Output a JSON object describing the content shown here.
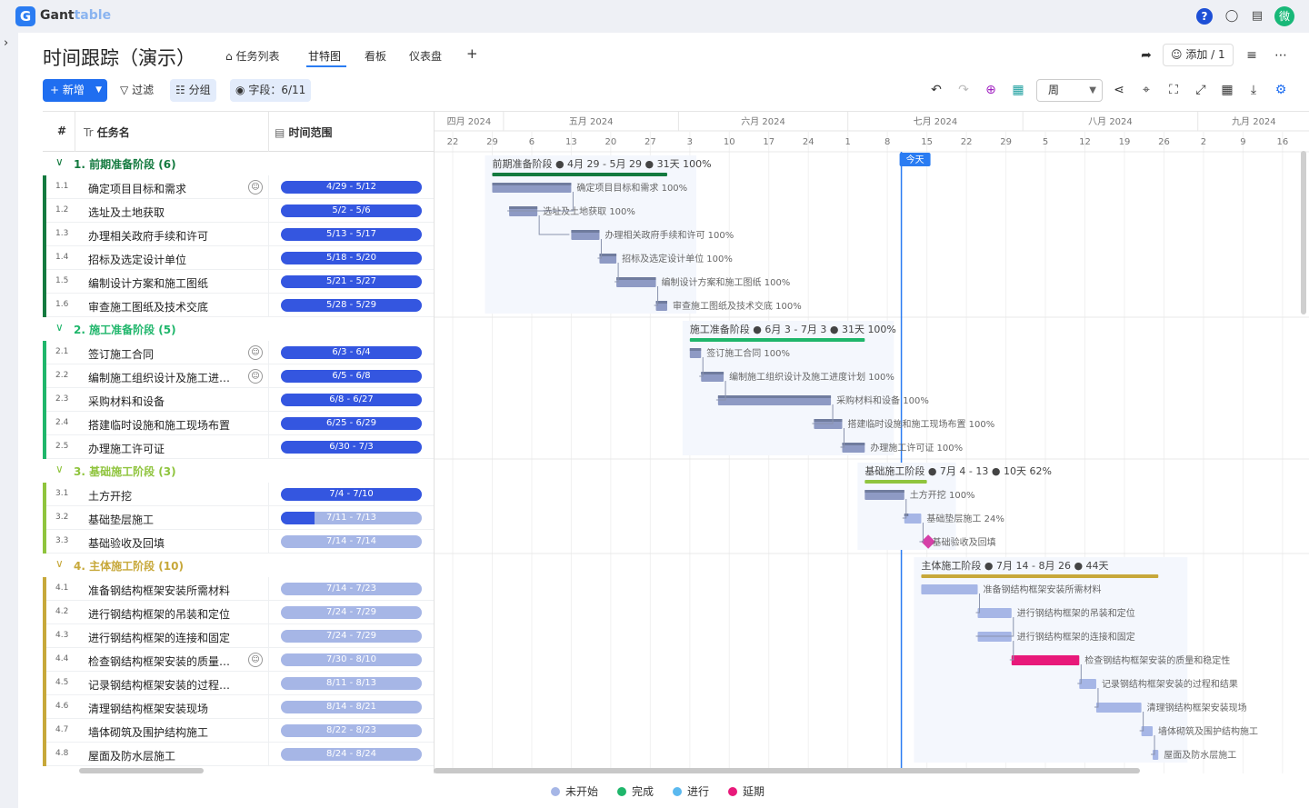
{
  "app": {
    "logo_letter": "G",
    "logo_main": "Gant",
    "logo_sub": "table",
    "avatar_text": "微",
    "help_text": "?"
  },
  "header": {
    "title": "时间跟踪（演示）",
    "tabs": [
      "任务列表",
      "甘特图",
      "看板",
      "仪表盘"
    ],
    "active_tab": "甘特图",
    "add_tab": "+",
    "add_member_label": "添加 / 1"
  },
  "toolbar": {
    "new_label": "新增",
    "filter_label": "过滤",
    "group_label": "分组",
    "fields_label": "字段：6/11",
    "scale_value": "周"
  },
  "grid": {
    "col_num": "#",
    "col_name": "任务名",
    "col_range": "时间范围",
    "col_name_prefix": "Tr"
  },
  "colors": {
    "not_started": "#a6b6e6",
    "done": "#1fb66b",
    "in_progress": "#5bb9ef",
    "delayed": "#e8197a",
    "group1": "#147a3f",
    "group2": "#1fb66b",
    "group3": "#8fc43d",
    "group4": "#c7a83a",
    "today": "#2a7cf2"
  },
  "groups": [
    {
      "label": "1. 前期准备阶段 (6)",
      "color": "#147a3f",
      "gantt_label": "前期准备阶段 ● 4月 29 - 5月 29 ● 31天 100%",
      "tasks": [
        {
          "no": "1.1",
          "name": "确定项目目标和需求",
          "range": "4/29 - 5/12",
          "progress": 100,
          "icon": true,
          "bar_label": "确定项目目标和需求 100%"
        },
        {
          "no": "1.2",
          "name": "选址及土地获取",
          "range": "5/2 - 5/6",
          "progress": 100,
          "bar_label": "选址及土地获取 100%"
        },
        {
          "no": "1.3",
          "name": "办理相关政府手续和许可",
          "range": "5/13 - 5/17",
          "progress": 100,
          "bar_label": "办理相关政府手续和许可 100%"
        },
        {
          "no": "1.4",
          "name": "招标及选定设计单位",
          "range": "5/18 - 5/20",
          "progress": 100,
          "bar_label": "招标及选定设计单位 100%"
        },
        {
          "no": "1.5",
          "name": "编制设计方案和施工图纸",
          "range": "5/21 - 5/27",
          "progress": 100,
          "bar_label": "编制设计方案和施工图纸 100%"
        },
        {
          "no": "1.6",
          "name": "审查施工图纸及技术交底",
          "range": "5/28 - 5/29",
          "progress": 100,
          "bar_label": "审查施工图纸及技术交底 100%"
        }
      ]
    },
    {
      "label": "2. 施工准备阶段 (5)",
      "color": "#1fb66b",
      "gantt_label": "施工准备阶段 ● 6月 3 - 7月 3 ● 31天 100%",
      "tasks": [
        {
          "no": "2.1",
          "name": "签订施工合同",
          "range": "6/3 - 6/4",
          "progress": 100,
          "icon": true,
          "bar_label": "签订施工合同 100%"
        },
        {
          "no": "2.2",
          "name": "编制施工组织设计及施工进度计划",
          "range": "6/5 - 6/8",
          "progress": 100,
          "icon": true,
          "bar_label": "编制施工组织设计及施工进度计划 100%"
        },
        {
          "no": "2.3",
          "name": "采购材料和设备",
          "range": "6/8 - 6/27",
          "progress": 100,
          "bar_label": "采购材料和设备 100%"
        },
        {
          "no": "2.4",
          "name": "搭建临时设施和施工现场布置",
          "range": "6/25 - 6/29",
          "progress": 100,
          "bar_label": "搭建临时设施和施工现场布置 100%"
        },
        {
          "no": "2.5",
          "name": "办理施工许可证",
          "range": "6/30 - 7/3",
          "progress": 100,
          "bar_label": "办理施工许可证 100%"
        }
      ]
    },
    {
      "label": "3. 基础施工阶段 (3)",
      "color": "#8fc43d",
      "gantt_label": "基础施工阶段 ● 7月 4 - 13 ● 10天 62%",
      "tasks": [
        {
          "no": "3.1",
          "name": "土方开挖",
          "range": "7/4 - 7/10",
          "progress": 100,
          "bar_label": "土方开挖 100%"
        },
        {
          "no": "3.2",
          "name": "基础垫层施工",
          "range": "7/11 - 7/13",
          "progress": 24,
          "bar_label": "基础垫层施工 24%"
        },
        {
          "no": "3.3",
          "name": "基础验收及回填",
          "range": "7/14 - 7/14",
          "progress": 0,
          "bar_label": "基础验收及回填"
        }
      ]
    },
    {
      "label": "4. 主体施工阶段 (10)",
      "color": "#c7a83a",
      "gantt_label": "主体施工阶段 ● 7月 14 - 8月 26 ● 44天",
      "tasks": [
        {
          "no": "4.1",
          "name": "准备钢结构框架安装所需材料",
          "range": "7/14 - 7/23",
          "progress": 0,
          "bar_label": "准备钢结构框架安装所需材料"
        },
        {
          "no": "4.2",
          "name": "进行钢结构框架的吊装和定位",
          "range": "7/24 - 7/29",
          "progress": 0,
          "bar_label": "进行钢结构框架的吊装和定位"
        },
        {
          "no": "4.3",
          "name": "进行钢结构框架的连接和固定",
          "range": "7/24 - 7/29",
          "progress": 0,
          "bar_label": "进行钢结构框架的连接和固定"
        },
        {
          "no": "4.4",
          "name": "检查钢结构框架安装的质量和稳定性",
          "range": "7/30 - 8/10",
          "progress": 0,
          "icon": true,
          "delayed": true,
          "bar_label": "检查钢结构框架安装的质量和稳定性"
        },
        {
          "no": "4.5",
          "name": "记录钢结构框架安装的过程和结果",
          "range": "8/11 - 8/13",
          "progress": 0,
          "bar_label": "记录钢结构框架安装的过程和结果"
        },
        {
          "no": "4.6",
          "name": "清理钢结构框架安装现场",
          "range": "8/14 - 8/21",
          "progress": 0,
          "bar_label": "清理钢结构框架安装现场"
        },
        {
          "no": "4.7",
          "name": "墙体砌筑及围护结构施工",
          "range": "8/22 - 8/23",
          "progress": 0,
          "bar_label": "墙体砌筑及围护结构施工"
        },
        {
          "no": "4.8",
          "name": "屋面及防水层施工",
          "range": "8/24 - 8/24",
          "progress": 0,
          "bar_label": "屋面及防水层施工"
        }
      ]
    }
  ],
  "timeline": {
    "months": [
      "四月 2024",
      "五月 2024",
      "六月 2024",
      "七月 2024",
      "八月 2024",
      "九月 2024"
    ],
    "weeks": [
      "22",
      "29",
      "6",
      "13",
      "20",
      "27",
      "3",
      "10",
      "17",
      "24",
      "1",
      "8",
      "15",
      "22",
      "29",
      "5",
      "12",
      "19",
      "26",
      "2",
      "9",
      "16"
    ],
    "today_label": "今天",
    "today": "7/10"
  },
  "legend": [
    {
      "label": "未开始",
      "color": "#a6b6e6"
    },
    {
      "label": "完成",
      "color": "#1fb66b"
    },
    {
      "label": "进行",
      "color": "#5bb9ef"
    },
    {
      "label": "延期",
      "color": "#e8197a"
    }
  ]
}
